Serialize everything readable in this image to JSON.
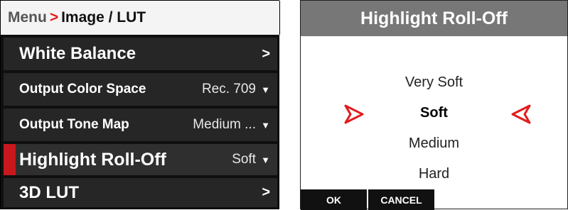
{
  "breadcrumb": {
    "root": "Menu",
    "separator": ">",
    "current": "Image / LUT"
  },
  "menu": {
    "items": [
      {
        "label": "White Balance",
        "value": "",
        "indicator": ">"
      },
      {
        "label": "Output Color Space",
        "value": "Rec. 709",
        "indicator": "▼"
      },
      {
        "label": "Output Tone Map",
        "value": "Medium ...",
        "indicator": "▼"
      },
      {
        "label": "Highlight Roll-Off",
        "value": "Soft",
        "indicator": "▼",
        "selected": true
      },
      {
        "label": "3D LUT",
        "value": "",
        "indicator": ">"
      }
    ]
  },
  "dialog": {
    "title": "Highlight Roll-Off",
    "options": [
      "Very Soft",
      "Soft",
      "Medium",
      "Hard"
    ],
    "selected_option": "Soft",
    "ok_label": "OK",
    "cancel_label": "CANCEL"
  },
  "colors": {
    "accent": "#e31b1b",
    "selection_bar": "#c8181d",
    "row_bg": "#262626",
    "dialog_header": "#777777"
  }
}
